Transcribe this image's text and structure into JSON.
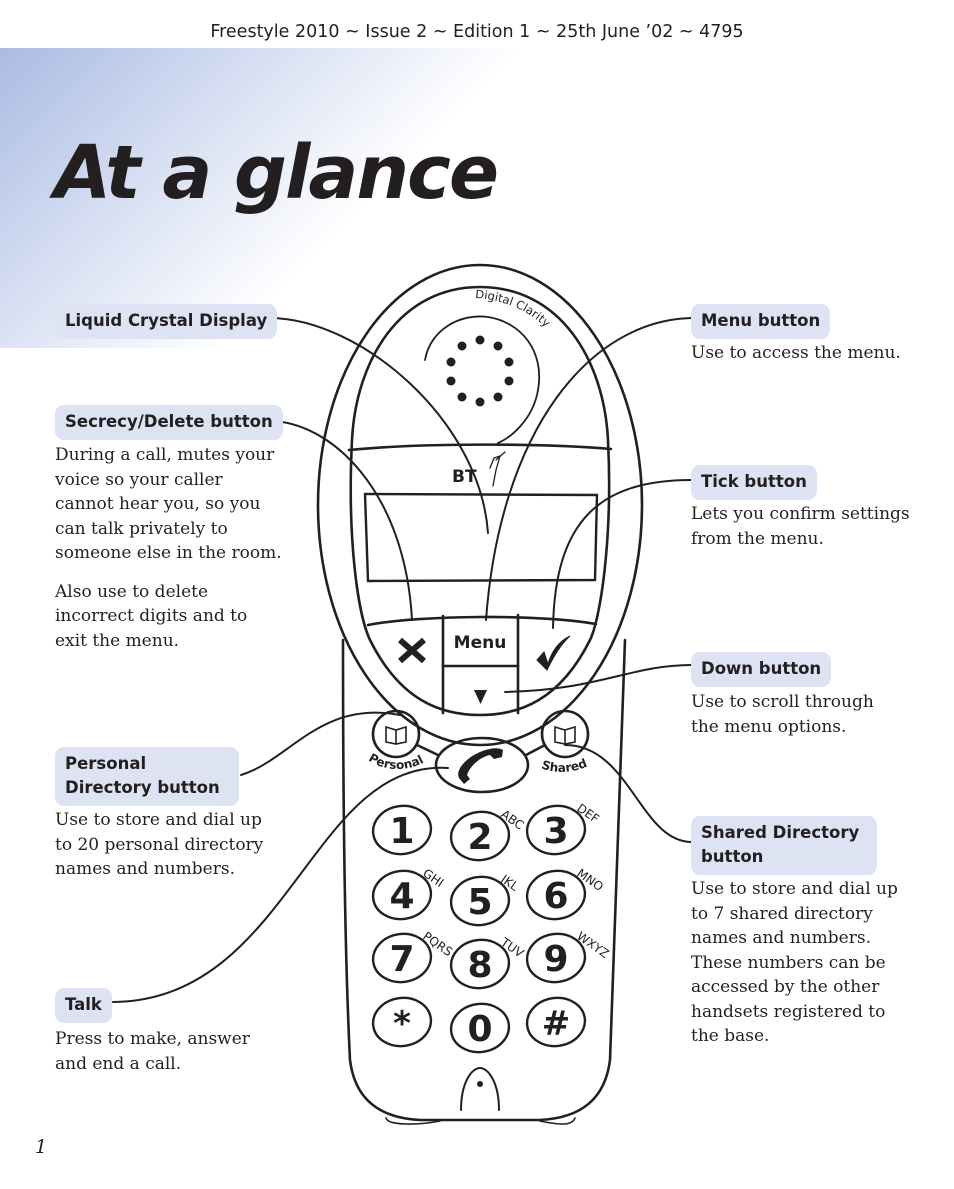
{
  "header": {
    "text": "Freestyle 2010 ~ Issue 2 ~ Edition 1 ~ 25th June ’02 ~ 4795"
  },
  "title": "At a glance",
  "page_number": "1",
  "callouts": {
    "lcd": {
      "label": "Liquid Crystal Display"
    },
    "secrecy": {
      "label": "Secrecy/Delete button",
      "paragraphs": [
        "During a call, mutes your voice so your caller cannot hear you, so you can talk privately to someone else in the room.",
        "Also use to delete incorrect digits and to exit the menu."
      ]
    },
    "personal": {
      "label": "Personal Directory button",
      "description": "Use to store and dial up to 20 personal directory names and numbers."
    },
    "talk": {
      "label": "Talk",
      "description": "Press to make, answer and end a call."
    },
    "menu": {
      "label": "Menu button",
      "description": "Use to access the menu."
    },
    "tick": {
      "label": "Tick button",
      "description": "Lets you confirm settings from the menu."
    },
    "down": {
      "label": "Down button",
      "description": "Use to scroll through the menu options."
    },
    "shared": {
      "label": "Shared Directory button",
      "description": "Use to store and dial up to 7 shared directory names and numbers. These numbers can be accessed by the other handsets registered to the base."
    }
  },
  "phone": {
    "brand_text": "Digital Clarity",
    "logo": "BT",
    "menu_key": "Menu",
    "secrecy_icon": "cross-icon",
    "tick_icon": "tick-icon",
    "down_icon": "down-arrow-icon",
    "personal_label": "Personal",
    "shared_label": "Shared",
    "directory_icon": "book-icon",
    "talk_icon": "handset-icon",
    "keys": [
      {
        "digit": "1",
        "letters": ""
      },
      {
        "digit": "2",
        "letters": "ABC"
      },
      {
        "digit": "3",
        "letters": "DEF"
      },
      {
        "digit": "4",
        "letters": "GHI"
      },
      {
        "digit": "5",
        "letters": "JKL"
      },
      {
        "digit": "6",
        "letters": "MNO"
      },
      {
        "digit": "7",
        "letters": "PQRS"
      },
      {
        "digit": "8",
        "letters": "TUV"
      },
      {
        "digit": "9",
        "letters": "WXYZ"
      },
      {
        "digit": "*",
        "letters": ""
      },
      {
        "digit": "0",
        "letters": ""
      },
      {
        "digit": "#",
        "letters": ""
      }
    ]
  }
}
